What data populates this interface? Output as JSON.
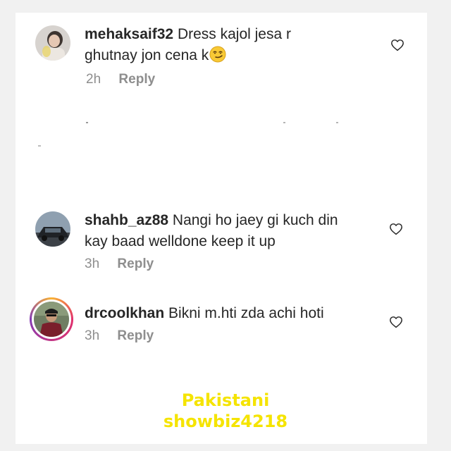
{
  "comments": [
    {
      "username": "mehaksaif32",
      "text_line1": "Dress kajol jesa r",
      "text_line2": "ghutnay jon cena k",
      "emoji": "smirking-face",
      "time": "2h",
      "reply_label": "Reply"
    },
    {
      "username": "shahb_az88",
      "text_line1": "Nangi ho jaey gi kuch din",
      "text_line2": "kay baad welldone keep it up",
      "time": "3h",
      "reply_label": "Reply"
    },
    {
      "username": "drcoolkhan",
      "text_line1": "Bikni m.hti zda achi hoti",
      "time": "3h",
      "reply_label": "Reply"
    }
  ],
  "watermark": {
    "line1": "Pakistani",
    "line2": "showbiz4218",
    "color": "#f5e400"
  },
  "icons": {
    "like": "heart-outline-icon"
  }
}
